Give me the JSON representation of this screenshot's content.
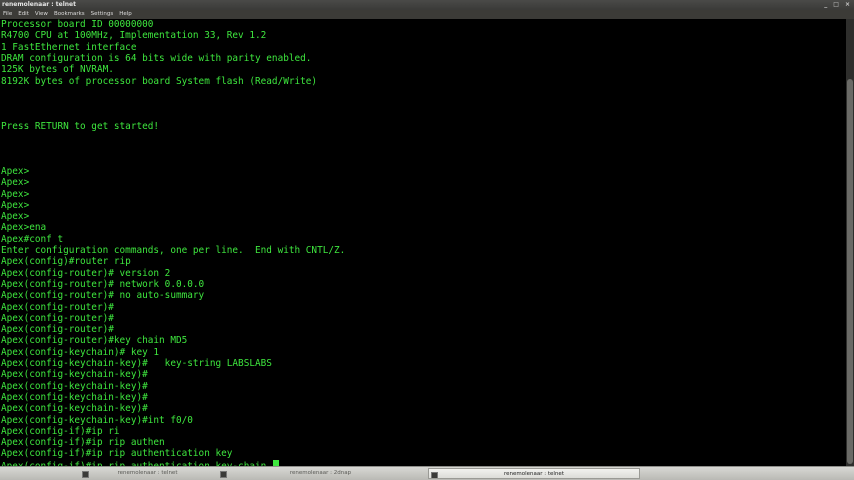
{
  "window": {
    "title": "renemolenaar : telnet",
    "controls": [
      "_",
      "□",
      "×"
    ]
  },
  "menu": {
    "items": [
      "File",
      "Edit",
      "View",
      "Bookmarks",
      "Settings",
      "Help"
    ]
  },
  "terminal": {
    "lines": [
      "Processor board ID 00000000",
      "R4700 CPU at 100MHz, Implementation 33, Rev 1.2",
      "1 FastEthernet interface",
      "DRAM configuration is 64 bits wide with parity enabled.",
      "125K bytes of NVRAM.",
      "8192K bytes of processor board System flash (Read/Write)",
      "",
      "",
      "",
      "Press RETURN to get started!",
      "",
      "",
      "",
      "Apex>",
      "Apex>",
      "Apex>",
      "Apex>",
      "Apex>",
      "Apex>ena",
      "Apex#conf t",
      "Enter configuration commands, one per line.  End with CNTL/Z.",
      "Apex(config)#router rip",
      "Apex(config-router)# version 2",
      "Apex(config-router)# network 0.0.0.0",
      "Apex(config-router)# no auto-summary",
      "Apex(config-router)#",
      "Apex(config-router)#",
      "Apex(config-router)#",
      "Apex(config-router)#key chain MD5",
      "Apex(config-keychain)# key 1",
      "Apex(config-keychain-key)#   key-string LABSLABS",
      "Apex(config-keychain-key)#",
      "Apex(config-keychain-key)#",
      "Apex(config-keychain-key)#",
      "Apex(config-keychain-key)#",
      "Apex(config-keychain-key)#int f0/0",
      "Apex(config-if)#ip ri",
      "Apex(config-if)#ip rip authen",
      "Apex(config-if)#ip rip authentication key",
      "Apex(config-if)#ip rip authentication key-chain "
    ],
    "text_color": "#3ee63e",
    "background": "#000000"
  },
  "taskbar": {
    "items": [
      {
        "label": "renemolenaar : telnet",
        "active": false
      },
      {
        "label": "renemolenaar : 2dnap",
        "active": false
      },
      {
        "label": "renemolenaar : telnet",
        "active": true
      }
    ]
  }
}
